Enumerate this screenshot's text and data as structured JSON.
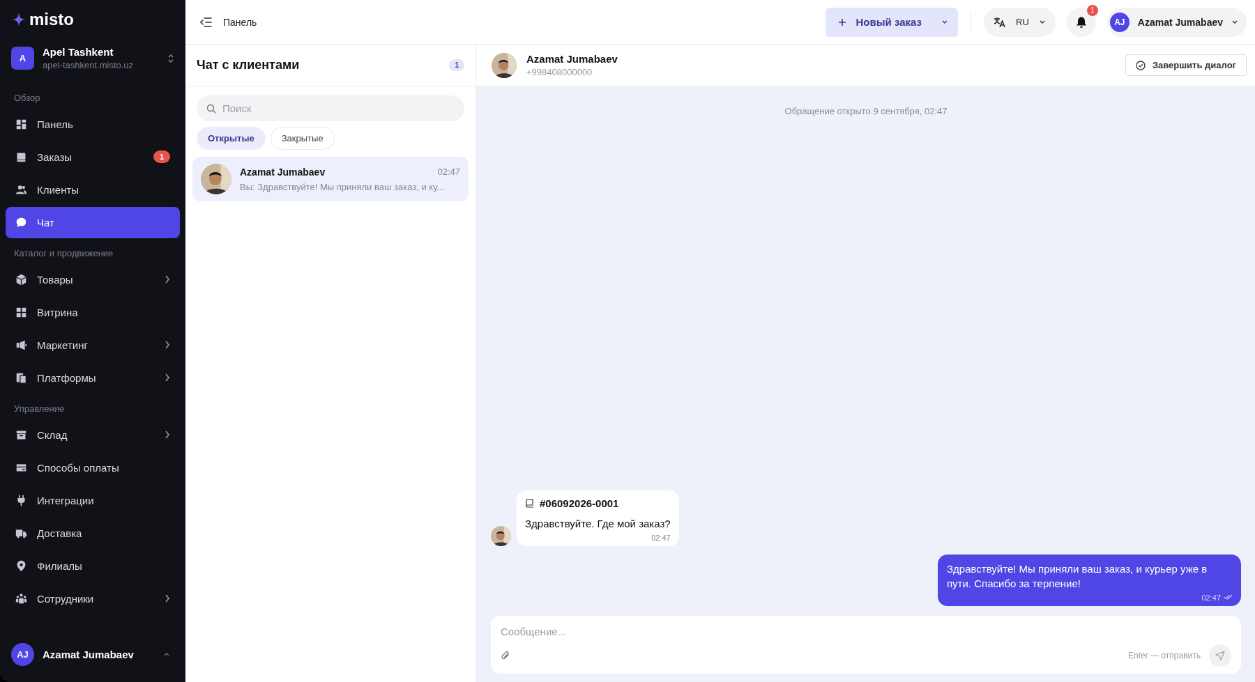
{
  "sidebar": {
    "logo": "misto",
    "store": {
      "initial": "A",
      "name": "Apel Tashkent",
      "domain": "apel-tashkent.misto.uz"
    },
    "sections": [
      {
        "title": "Обзор",
        "items": [
          {
            "label": "Панель",
            "selected": false,
            "submenu": false
          },
          {
            "label": "Заказы",
            "selected": false,
            "submenu": false,
            "badge": "1"
          },
          {
            "label": "Клиенты",
            "selected": false,
            "submenu": false
          },
          {
            "label": "Чат",
            "selected": true,
            "submenu": false
          }
        ]
      },
      {
        "title": "Каталог и продвижение",
        "items": [
          {
            "label": "Товары",
            "selected": false,
            "submenu": true
          },
          {
            "label": "Витрина",
            "selected": false,
            "submenu": false
          },
          {
            "label": "Маркетинг",
            "selected": false,
            "submenu": true
          },
          {
            "label": "Платформы",
            "selected": false,
            "submenu": true
          }
        ]
      },
      {
        "title": "Управление",
        "items": [
          {
            "label": "Склад",
            "selected": false,
            "submenu": true
          },
          {
            "label": "Способы оплаты",
            "selected": false,
            "submenu": false
          },
          {
            "label": "Интеграции",
            "selected": false,
            "submenu": false
          },
          {
            "label": "Доставка",
            "selected": false,
            "submenu": false
          },
          {
            "label": "Филиалы",
            "selected": false,
            "submenu": false
          },
          {
            "label": "Сотрудники",
            "selected": false,
            "submenu": true
          }
        ]
      }
    ],
    "user": {
      "initials": "AJ",
      "name": "Azamat Jumabaev"
    }
  },
  "topbar": {
    "breadcrumb": "Панель",
    "new_order": "Новый заказ",
    "language": "RU",
    "notifications": "1",
    "user": {
      "initials": "AJ",
      "name": "Azamat Jumabaev"
    }
  },
  "chat_list": {
    "title": "Чат с клиентами",
    "count": "1",
    "search": {
      "placeholder": "Поиск"
    },
    "filters": [
      {
        "label": "Открытые",
        "selected": true
      },
      {
        "label": "Закрытые",
        "selected": false
      }
    ],
    "conversations": [
      {
        "name": "Azamat Jumabaev",
        "time": "02:47",
        "preview": "Вы: Здравствуйте! Мы приняли ваш заказ, и ку...",
        "selected": true
      }
    ]
  },
  "conversation": {
    "name": "Azamat Jumabaev",
    "phone": "+998408000000",
    "close_button": "Завершить диалог",
    "opened_note": "Обращение открыто 9 сентября, 02:47",
    "messages": [
      {
        "kind": "incoming",
        "order_ref": "#06092026-0001",
        "text": "Здравствуйте. Где мой заказ?",
        "time": "02:47"
      },
      {
        "kind": "outgoing",
        "text": "Здравствуйте! Мы приняли ваш заказ, и курьер уже в пути. Спасибо за терпение!",
        "time": "02:47",
        "read": true
      }
    ],
    "composer": {
      "placeholder": "Сообщение...",
      "hint": "Enter — отправить"
    }
  }
}
